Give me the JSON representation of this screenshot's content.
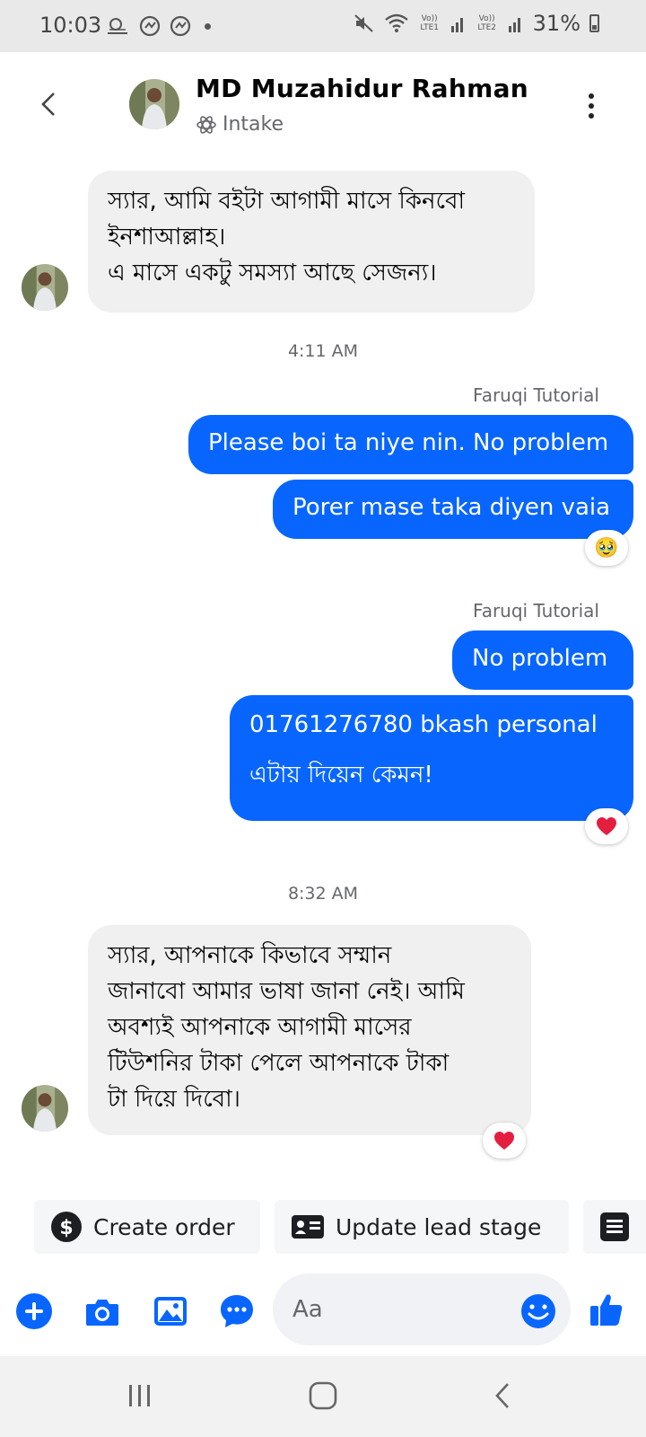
{
  "status_bar": {
    "time": "10:03",
    "lte1": "Vo)) LTE1",
    "lte2": "Vo)) LTE2",
    "battery": "31%"
  },
  "header": {
    "contact_name": "MD Muzahidur Rahman",
    "lead_stage": "Intake"
  },
  "messages": {
    "m1": {
      "line1": "স্যার, আমি বইটা আগামী মাসে কিনবো",
      "line2": "ইনশাআল্লাহ।",
      "line3": "এ মাসে একটু সমস্যা আছে সেজন্য।"
    },
    "ts1": "4:11 AM",
    "sender1": "Faruqi Tutorial",
    "m2": "Please boi ta niye nin. No problem",
    "m3": "Porer mase taka diyen vaia",
    "m3_reaction": "🥹",
    "sender2": "Faruqi Tutorial",
    "m4": "No problem",
    "m5": {
      "line1": "01761276780 bkash personal",
      "line2": "এটায় দিয়েন কেমন!"
    },
    "m5_reaction": "heart",
    "ts2": "8:32 AM",
    "m6": {
      "line1": "স্যার, আপনাকে কিভাবে সম্মান",
      "line2": "জানাবো আমার ভাষা জানা নেই। আমি",
      "line3": "অবশ্যই আপনাকে আগামী মাসের",
      "line4": "টিউশনির টাকা পেলে আপনাকে টাকা",
      "line5": "টা দিয়ে দিবো।"
    },
    "m6_reaction": "heart"
  },
  "quick_actions": {
    "create_order": "Create order",
    "update_lead_stage": "Update lead stage"
  },
  "composer": {
    "placeholder": "Aa"
  },
  "colors": {
    "accent": "#0866ff",
    "incoming_bubble": "#f0f0f0",
    "reaction_heart": "#e41e3f"
  }
}
